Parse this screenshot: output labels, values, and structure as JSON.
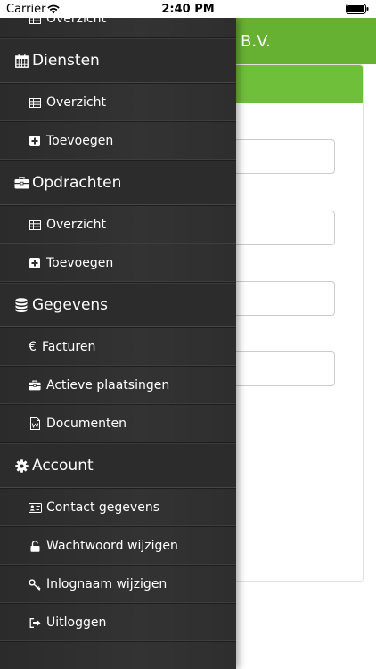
{
  "status_bar": {
    "carrier": "Carrier",
    "time": "2:40 PM"
  },
  "background": {
    "header_title": "B.V."
  },
  "drawer": {
    "items": [
      {
        "label": "Overzicht",
        "kind": "sub",
        "icon": "table-icon"
      },
      {
        "label": "Diensten",
        "kind": "header",
        "icon": "calendar-icon"
      },
      {
        "label": "Overzicht",
        "kind": "sub",
        "icon": "table-icon"
      },
      {
        "label": "Toevoegen",
        "kind": "sub",
        "icon": "plus-square-icon"
      },
      {
        "label": "Opdrachten",
        "kind": "header",
        "icon": "briefcase-icon"
      },
      {
        "label": "Overzicht",
        "kind": "sub",
        "icon": "table-icon"
      },
      {
        "label": "Toevoegen",
        "kind": "sub",
        "icon": "plus-square-icon"
      },
      {
        "label": "Gegevens",
        "kind": "header",
        "icon": "database-icon"
      },
      {
        "label": "Facturen",
        "kind": "sub",
        "icon": "euro-icon"
      },
      {
        "label": "Actieve plaatsingen",
        "kind": "sub",
        "icon": "briefcase-icon"
      },
      {
        "label": "Documenten",
        "kind": "sub",
        "icon": "word-document-icon"
      },
      {
        "label": "Account",
        "kind": "header",
        "icon": "gear-icon"
      },
      {
        "label": "Contact gegevens",
        "kind": "sub",
        "icon": "contact-card-icon"
      },
      {
        "label": "Wachtwoord wijzigen",
        "kind": "sub",
        "icon": "unlock-icon"
      },
      {
        "label": "Inlognaam wijzigen",
        "kind": "sub",
        "icon": "key-icon"
      },
      {
        "label": "Uitloggen",
        "kind": "sub",
        "icon": "logout-icon"
      }
    ]
  },
  "colors": {
    "accent_green": "#66b032",
    "drawer_bg": "#2f2f2f",
    "drawer_text": "#ffffff"
  }
}
